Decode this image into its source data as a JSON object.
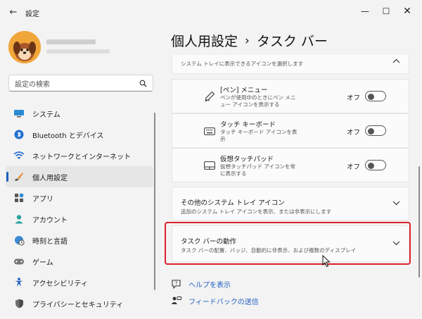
{
  "window": {
    "title": "設定",
    "back_glyph": "←",
    "minimize_glyph": "—",
    "maximize_glyph": "☐",
    "close_glyph": "✕"
  },
  "search": {
    "placeholder": "設定の検索"
  },
  "nav": {
    "items": [
      {
        "label": "システム",
        "icon": "monitor-icon"
      },
      {
        "label": "Bluetooth とデバイス",
        "icon": "bluetooth-icon"
      },
      {
        "label": "ネットワークとインターネット",
        "icon": "wifi-icon"
      },
      {
        "label": "個人用設定",
        "icon": "brush-icon",
        "active": true
      },
      {
        "label": "アプリ",
        "icon": "apps-icon"
      },
      {
        "label": "アカウント",
        "icon": "person-icon"
      },
      {
        "label": "時刻と言語",
        "icon": "globe-clock-icon"
      },
      {
        "label": "ゲーム",
        "icon": "gamepad-icon"
      },
      {
        "label": "アクセシビリティ",
        "icon": "accessibility-icon"
      },
      {
        "label": "プライバシーとセキュリティ",
        "icon": "shield-icon"
      }
    ]
  },
  "heading": {
    "parent": "個人用設定",
    "separator": "›",
    "current": "タスク バー"
  },
  "tray_section": {
    "subtitle": "システム トレイに表示できるアイコンを選択します"
  },
  "rows": [
    {
      "title": "[ペン] メニュー",
      "desc": "ペンが使用中のときにペン メニュー アイコンを表示する",
      "state": "オフ",
      "icon": "pen-icon"
    },
    {
      "title": "タッチ キーボード",
      "desc": "タッチ キーボード アイコンを表示",
      "state": "オフ",
      "icon": "keyboard-icon"
    },
    {
      "title": "仮想タッチパッド",
      "desc": "仮想タッチパッド アイコンを常に表示する",
      "state": "オフ",
      "icon": "touchpad-icon"
    }
  ],
  "other_tray": {
    "title": "その他のシステム トレイ アイコン",
    "desc": "追加のシステム トレイ アイコンを表示、または非表示にします"
  },
  "behaviors": {
    "title": "タスク バーの動作",
    "desc": "タスク バーの配置、バッジ、自動的に非表示、および複数のディスプレイ"
  },
  "links": {
    "help": "ヘルプを表示",
    "feedback": "フィードバックの送信"
  },
  "colors": {
    "accent": "#1f5fbf",
    "highlight": "#e0202a",
    "avatar": "#f1a63a"
  }
}
